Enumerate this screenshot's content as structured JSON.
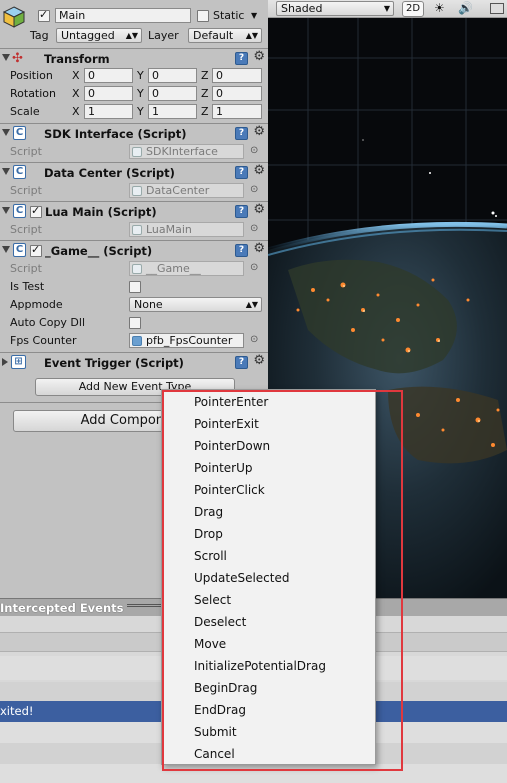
{
  "gameobject": {
    "name": "Main",
    "static_label": "Static",
    "tag_label": "Tag",
    "tag_value": "Untagged",
    "layer_label": "Layer",
    "layer_value": "Default"
  },
  "transform": {
    "title": "Transform",
    "position_label": "Position",
    "rotation_label": "Rotation",
    "scale_label": "Scale",
    "axis_x": "X",
    "axis_y": "Y",
    "axis_z": "Z",
    "position": [
      "0",
      "0",
      "0"
    ],
    "rotation": [
      "0",
      "0",
      "0"
    ],
    "scale": [
      "1",
      "1",
      "1"
    ]
  },
  "components": {
    "script_label": "Script",
    "sdk": {
      "title": "SDK Interface (Script)",
      "script": "SDKInterface"
    },
    "datacenter": {
      "title": "Data Center (Script)",
      "script": "DataCenter"
    },
    "luamain": {
      "title": "Lua Main (Script)",
      "script": "LuaMain"
    },
    "game": {
      "title": "_Game__ (Script)",
      "script": "__Game__",
      "is_test_label": "Is Test",
      "appmode_label": "Appmode",
      "appmode_value": "None",
      "autocopy_label": "Auto Copy Dll",
      "fps_label": "Fps Counter",
      "fps_value": "pfb_FpsCounter"
    },
    "eventtrigger": {
      "title": "Event Trigger (Script)",
      "add_event_label": "Add New Event Type"
    }
  },
  "add_component_label": "Add Component",
  "scene": {
    "shading_mode": "Shaded",
    "mode_2d": "2D"
  },
  "bottom": {
    "intercepted_label": "Intercepted Events",
    "log_text": "xited!"
  },
  "menu": {
    "items": [
      "PointerEnter",
      "PointerExit",
      "PointerDown",
      "PointerUp",
      "PointerClick",
      "Drag",
      "Drop",
      "Scroll",
      "UpdateSelected",
      "Select",
      "Deselect",
      "Move",
      "InitializePotentialDrag",
      "BeginDrag",
      "EndDrag",
      "Submit",
      "Cancel"
    ]
  },
  "colors": {
    "highlight_border": "#e0383e",
    "selection_blue": "#3c5fa0",
    "help_icon": "#4a7ab8"
  }
}
